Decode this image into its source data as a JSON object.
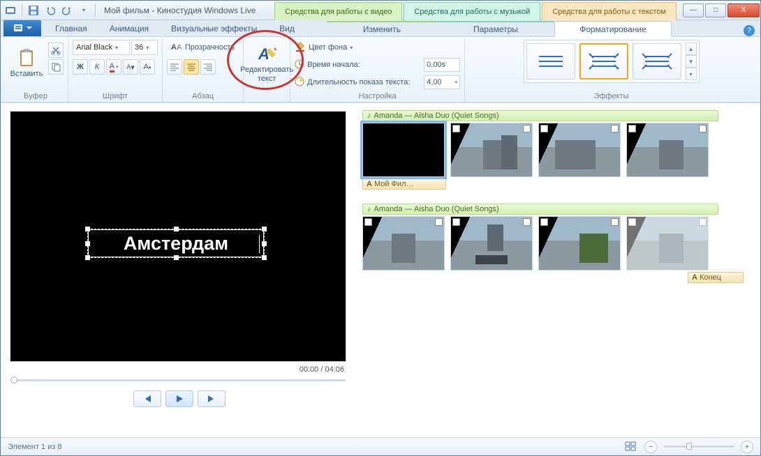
{
  "titlebar": {
    "app_title": "Мой фильм - Киностудия Windows Live",
    "tool_tabs": {
      "video": "Средства для работы с видео",
      "music": "Средства для работы с музыкой",
      "text": "Средства для работы с текстом"
    },
    "win": {
      "min": "—",
      "max": "□",
      "close": "X"
    }
  },
  "ribbon_tabs": {
    "home": "Главная",
    "anim": "Анимация",
    "vfx": "Визуальные эффекты",
    "view": "Вид",
    "video_edit": "Изменить",
    "music_params": "Параметры",
    "text_format": "Форматирование"
  },
  "ribbon": {
    "buffer": {
      "group": "Буфер",
      "paste": "Вставить"
    },
    "font": {
      "group": "Шрифт",
      "family": "Arial Black",
      "size": "36",
      "bold": "Ж",
      "italic": "К",
      "color": "A",
      "outline": "A",
      "sizeinc": "A"
    },
    "para": {
      "group": "Абзац",
      "transparency": "Прозрачность"
    },
    "edit": {
      "group": " ",
      "edit_text": "Редактировать текст"
    },
    "adjust": {
      "group": "Настройка",
      "bgcolor": "Цвет фона",
      "starttime": "Время начала:",
      "duration": "Длительность показа текста:",
      "starttime_val": "0,00s",
      "duration_val": "4,00"
    },
    "effects": {
      "group": "Эффекты"
    }
  },
  "preview": {
    "title_text": "Амстердам",
    "time": "00:00 / 04:06"
  },
  "timeline": {
    "music1": "Amanda — Aisha Duo (Quiet Songs)",
    "caption1": "Мой Фил…",
    "music2": "Amanda — Aisha Duo (Quiet Songs)",
    "caption_end": "Конец"
  },
  "statusbar": {
    "item": "Элемент 1 из 8"
  }
}
